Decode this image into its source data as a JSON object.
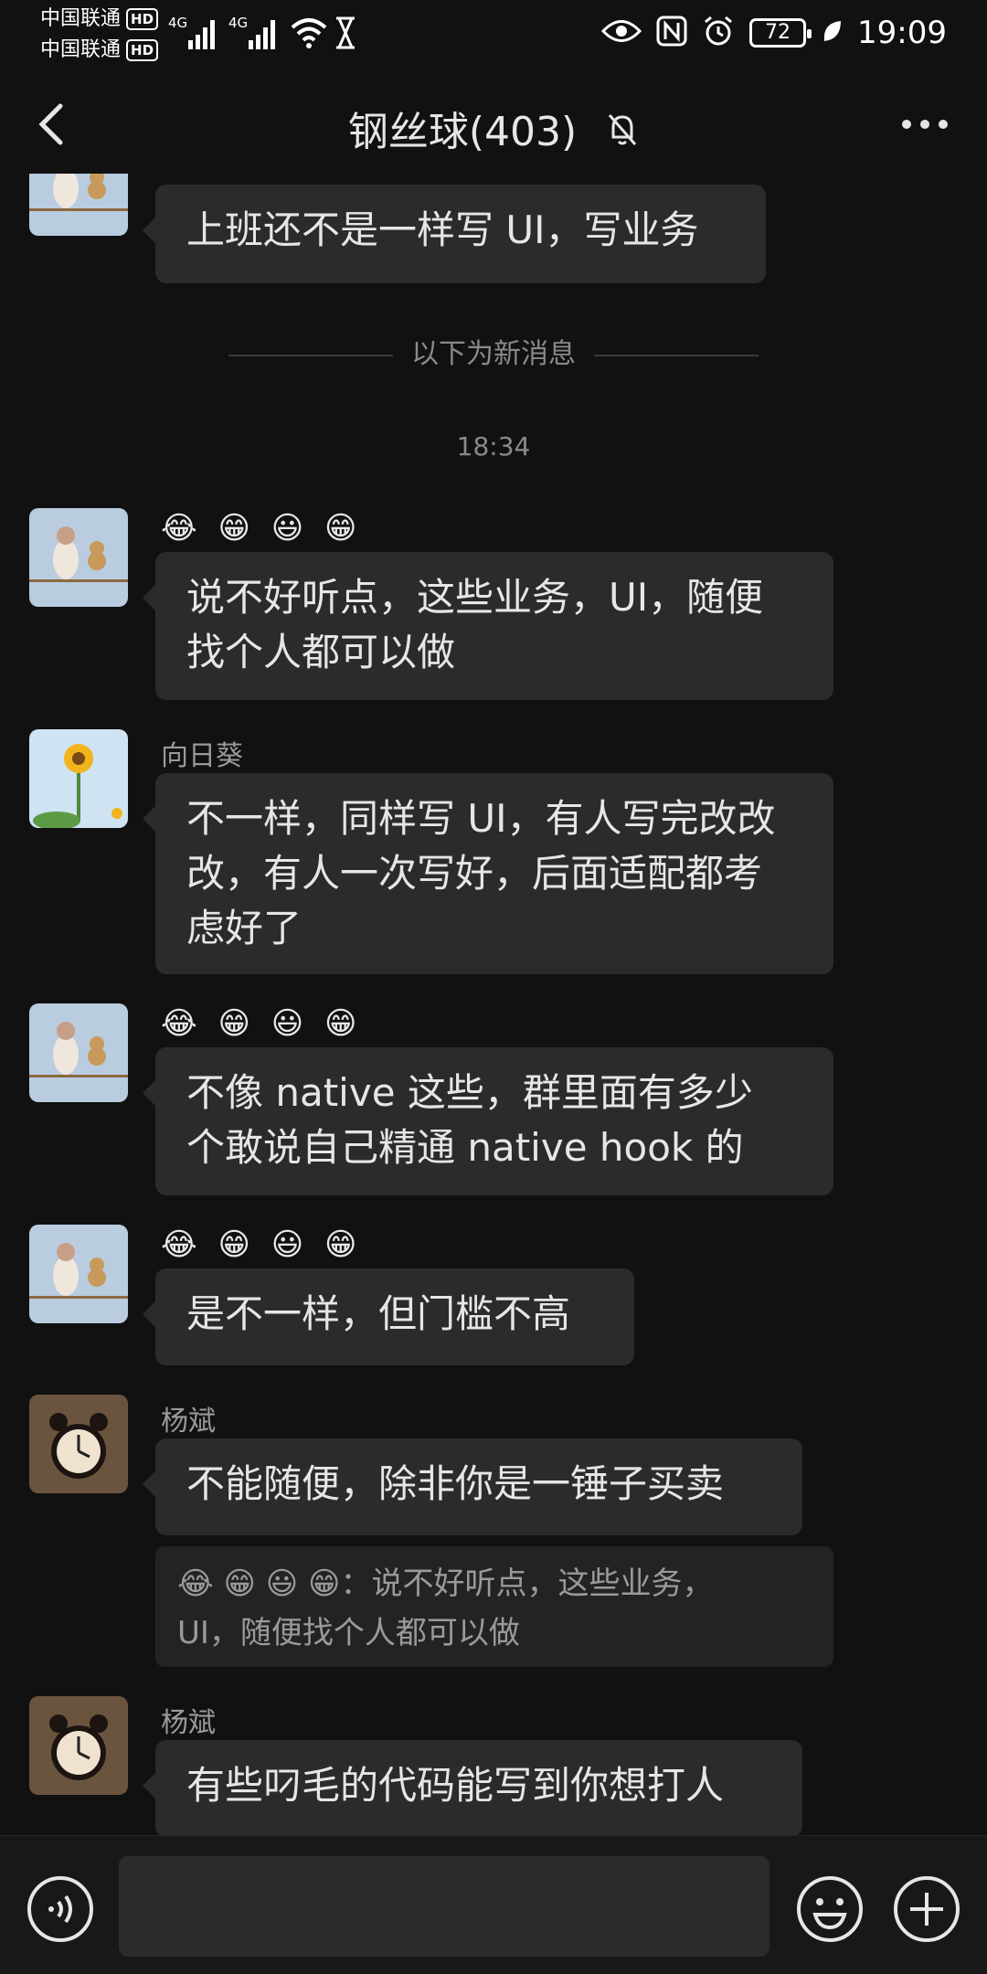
{
  "status_bar": {
    "carrier1": "中国联通",
    "carrier2": "中国联通",
    "hd_badge": "HD",
    "network1": "4G",
    "network2": "4G",
    "battery": "72",
    "time": "19:09"
  },
  "header": {
    "title": "钢丝球(403)",
    "back_icon": "chevron-left-icon",
    "mute_icon": "bell-off-icon",
    "more_icon": "more-dots-icon"
  },
  "chat": {
    "new_messages_divider": "以下为新消息",
    "timestamp": "18:34",
    "messages": [
      {
        "sender": "",
        "emoji": "",
        "text": "上班还不是一样写 UI，写业务"
      },
      {
        "sender": "",
        "emoji": "😂 😁 😃 😁",
        "text": "说不好听点，这些业务，UI，随便\n找个人都可以做"
      },
      {
        "sender": "向日葵",
        "emoji": "",
        "text": "不一样，同样写 UI，有人写完改改\n改，有人一次写好，后面适配都考\n虑好了"
      },
      {
        "sender": "",
        "emoji": "😂 😁 😃 😁",
        "text": "不像 native  这些，群里面有多少\n个敢说自己精通 native  hook 的"
      },
      {
        "sender": "",
        "emoji": "😂 😁 😃 😁",
        "text": "是不一样，但门槛不高"
      },
      {
        "sender": "杨斌",
        "emoji": "",
        "text": "不能随便，除非你是一锤子买卖",
        "quote": "😂 😁 😃 😁：说不好听点，这些业务，\nUI，随便找个人都可以做"
      },
      {
        "sender": "杨斌",
        "emoji": "",
        "text": "有些叼毛的代码能写到你想打人"
      }
    ]
  },
  "input_bar": {
    "voice_icon": "voice-icon",
    "emoji_icon": "smiley-icon",
    "plus_icon": "plus-circle-icon",
    "placeholder": ""
  }
}
